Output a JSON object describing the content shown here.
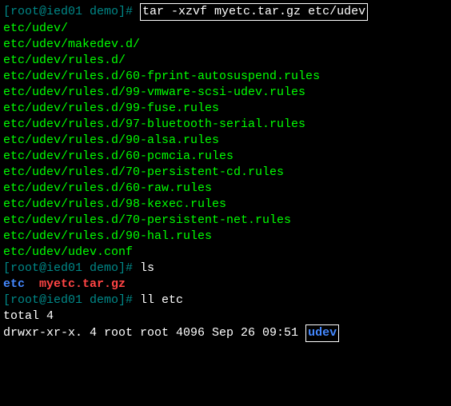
{
  "prompt1": {
    "userhost": "[root@ied01 demo]# ",
    "cmd": "tar -xzvf myetc.tar.gz etc/udev"
  },
  "tar_output": [
    "etc/udev/",
    "etc/udev/makedev.d/",
    "etc/udev/rules.d/",
    "etc/udev/rules.d/60-fprint-autosuspend.rules",
    "etc/udev/rules.d/99-vmware-scsi-udev.rules",
    "etc/udev/rules.d/99-fuse.rules",
    "etc/udev/rules.d/97-bluetooth-serial.rules",
    "etc/udev/rules.d/90-alsa.rules",
    "etc/udev/rules.d/60-pcmcia.rules",
    "etc/udev/rules.d/70-persistent-cd.rules",
    "etc/udev/rules.d/60-raw.rules",
    "etc/udev/rules.d/98-kexec.rules",
    "etc/udev/rules.d/70-persistent-net.rules",
    "etc/udev/rules.d/90-hal.rules",
    "etc/udev/udev.conf"
  ],
  "prompt2": {
    "userhost": "[root@ied01 demo]# ",
    "cmd": "ls"
  },
  "ls_output": {
    "dir": "etc",
    "sep": "  ",
    "file": "myetc.tar.gz"
  },
  "prompt3": {
    "userhost": "[root@ied01 demo]# ",
    "cmd": "ll etc"
  },
  "ll_output": {
    "total": "total 4",
    "perm": "drwxr-xr-x. 4 root root 4096 Sep 26 09:51 ",
    "name": "udev"
  }
}
